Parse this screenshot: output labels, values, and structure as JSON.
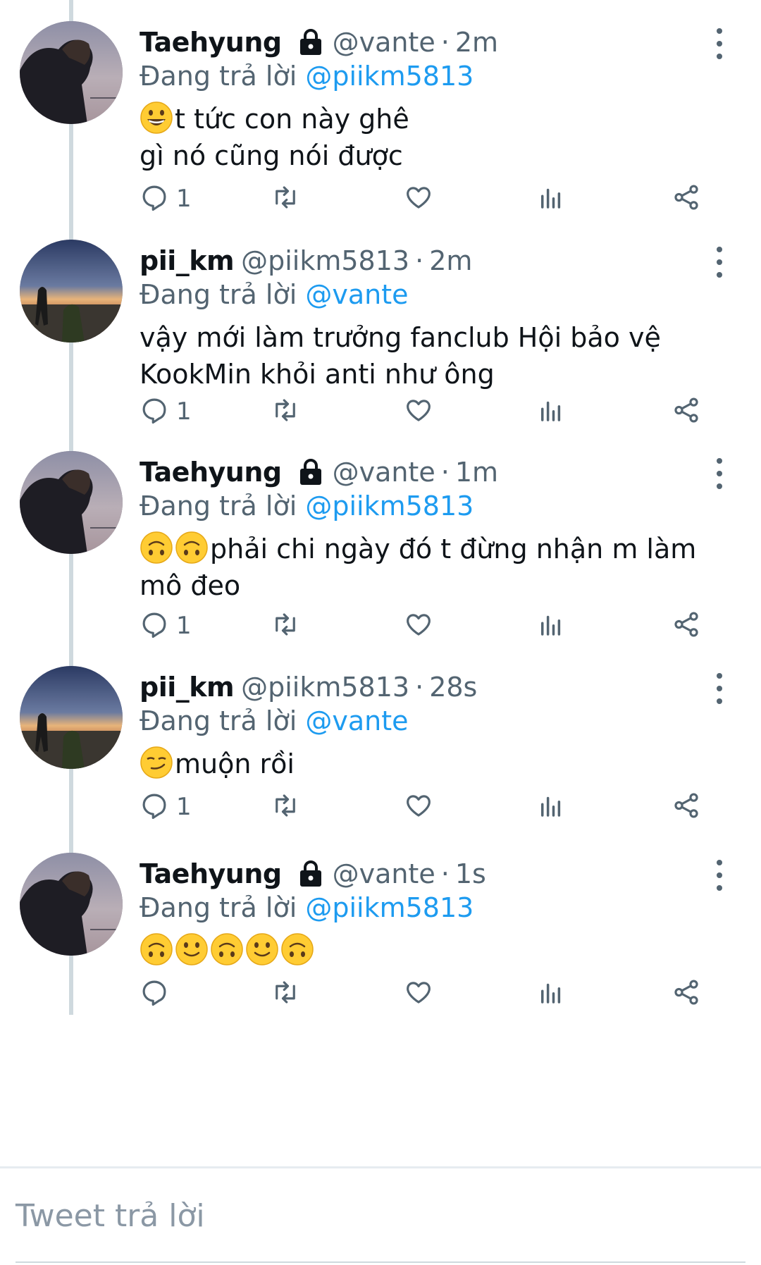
{
  "tweets": [
    {
      "user": "Taehyung",
      "locked": true,
      "handle": "@vante",
      "sep": "·",
      "time": "2m",
      "reply_prefix": "Đang trả lời",
      "reply_to": "@piikm5813",
      "emoji": [
        "grinning"
      ],
      "text": "t tức con này ghê\ngì nó cũng nói được",
      "reply_count": "1",
      "avatar": "boy-sunset-avatar"
    },
    {
      "user": "pii_km",
      "locked": false,
      "handle": "@piikm5813",
      "sep": "·",
      "time": "2m",
      "reply_prefix": "Đang trả lời",
      "reply_to": "@vante",
      "emoji": [],
      "text": "vậy mới làm trưởng fanclub Hội bảo vệ\nKookMin khỏi anti như ông",
      "reply_count": "1",
      "avatar": "beach-silhouettes-avatar"
    },
    {
      "user": "Taehyung",
      "locked": true,
      "handle": "@vante",
      "sep": "·",
      "time": "1m",
      "reply_prefix": "Đang trả lời",
      "reply_to": "@piikm5813",
      "emoji": [
        "upside-down",
        "upside-down"
      ],
      "text": "phải chi ngày đó t đừng nhận m làm\nmô đeo",
      "reply_count": "1",
      "avatar": "boy-sunset-avatar"
    },
    {
      "user": "pii_km",
      "locked": false,
      "handle": "@piikm5813",
      "sep": "·",
      "time": "28s",
      "reply_prefix": "Đang trả lời",
      "reply_to": "@vante",
      "emoji": [
        "smirking"
      ],
      "text": "muộn rồi",
      "reply_count": "1",
      "avatar": "beach-silhouettes-avatar"
    },
    {
      "user": "Taehyung",
      "locked": true,
      "handle": "@vante",
      "sep": "·",
      "time": "1s",
      "reply_prefix": "Đang trả lời",
      "reply_to": "@piikm5813",
      "emoji": [
        "upside-down",
        "slight-smile",
        "upside-down",
        "slight-smile",
        "upside-down"
      ],
      "text": "",
      "reply_count": "",
      "avatar": "boy-sunset-avatar"
    }
  ],
  "composer": {
    "placeholder": "Tweet trả lời"
  },
  "colors": {
    "text": "#0f1419",
    "secondary": "#536471",
    "link": "#1d9bf0",
    "thread": "#cfd9de"
  },
  "icons": [
    "lock-icon",
    "more-icon",
    "reply-icon",
    "retweet-icon",
    "like-icon",
    "analytics-icon",
    "share-icon"
  ]
}
